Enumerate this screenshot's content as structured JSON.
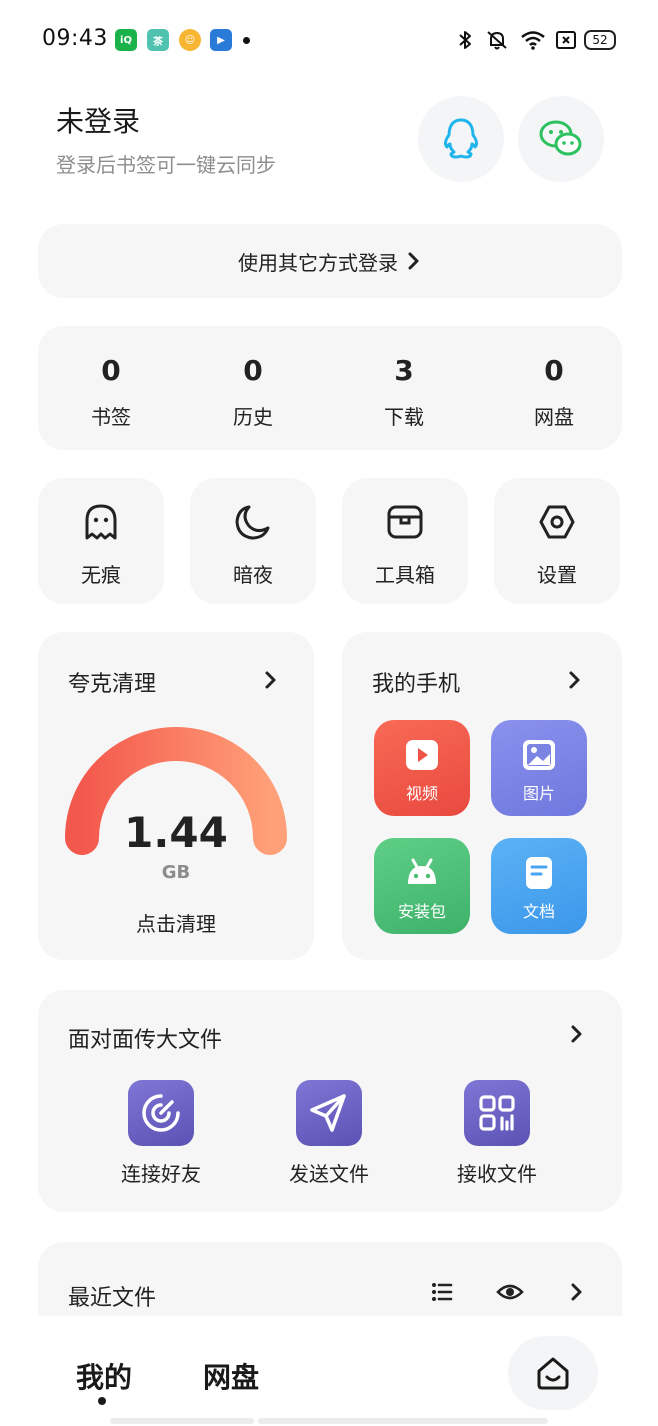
{
  "status_bar": {
    "time": "09:43",
    "app_icons": [
      "iqiyi-icon",
      "tea-app-icon",
      "cartoon-app-icon",
      "video-app-icon"
    ],
    "battery": "52"
  },
  "header": {
    "title": "未登录",
    "subtitle": "登录后书签可一键云同步"
  },
  "other_login": {
    "label": "使用其它方式登录"
  },
  "stats": [
    {
      "value": "0",
      "label": "书签"
    },
    {
      "value": "0",
      "label": "历史"
    },
    {
      "value": "3",
      "label": "下载"
    },
    {
      "value": "0",
      "label": "网盘"
    }
  ],
  "tools": [
    {
      "label": "无痕",
      "icon": "ghost-icon"
    },
    {
      "label": "暗夜",
      "icon": "moon-icon"
    },
    {
      "label": "工具箱",
      "icon": "toolbox-icon"
    },
    {
      "label": "设置",
      "icon": "settings-hex-icon"
    }
  ],
  "clean": {
    "title": "夸克清理",
    "size": "1.44",
    "unit": "GB",
    "action": "点击清理"
  },
  "phone": {
    "title": "我的手机",
    "items": [
      {
        "label": "视频",
        "icon": "video-play-icon"
      },
      {
        "label": "图片",
        "icon": "image-icon"
      },
      {
        "label": "安装包",
        "icon": "android-icon"
      },
      {
        "label": "文档",
        "icon": "document-icon"
      }
    ]
  },
  "f2f": {
    "title": "面对面传大文件",
    "items": [
      {
        "label": "连接好友",
        "icon": "radar-icon"
      },
      {
        "label": "发送文件",
        "icon": "send-icon"
      },
      {
        "label": "接收文件",
        "icon": "qr-code-icon"
      }
    ]
  },
  "recent": {
    "title": "最近文件"
  },
  "bottom_nav": {
    "tabs": [
      {
        "label": "我的",
        "active": true
      },
      {
        "label": "网盘",
        "active": false
      }
    ]
  },
  "colors": {
    "qq": "#1fb5ec",
    "wechat": "#2dc160",
    "gauge_start": "#f3584c",
    "gauge_end": "#ffa078",
    "video": "#f0584a",
    "image": "#7f86e6",
    "apk": "#4fc07a",
    "doc": "#4aa3f0",
    "f2f": "#6b62c4"
  }
}
